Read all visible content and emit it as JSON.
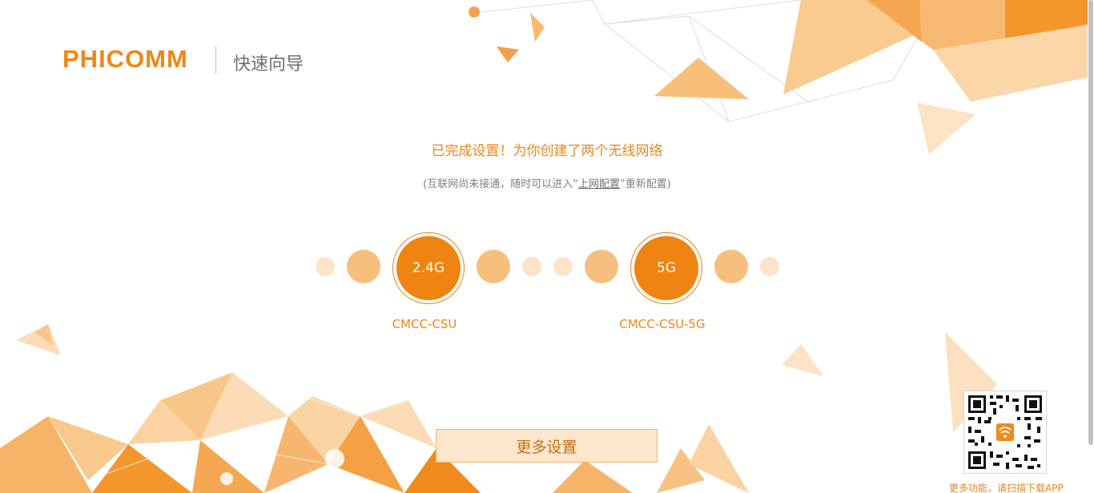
{
  "header": {
    "logo": "PHICOMM",
    "title": "快速向导"
  },
  "status": {
    "headline": "已完成设置！为你创建了两个无线网络",
    "note_prefix": "(互联网尚未接通，随时可以进入“",
    "note_link": "上网配置",
    "note_suffix": "”重新配置)"
  },
  "networks": [
    {
      "band": "2.4G",
      "ssid": "CMCC-CSU"
    },
    {
      "band": "5G",
      "ssid": "CMCC-CSU-5G"
    }
  ],
  "actions": {
    "more_settings": "更多设置"
  },
  "app": {
    "qr_caption": "更多功能，请扫描下载APP"
  },
  "colors": {
    "accent": "#ef8412",
    "accent_light": "#f6bf7e",
    "accent_pale": "#fde4c8",
    "text_gray": "#808080"
  }
}
